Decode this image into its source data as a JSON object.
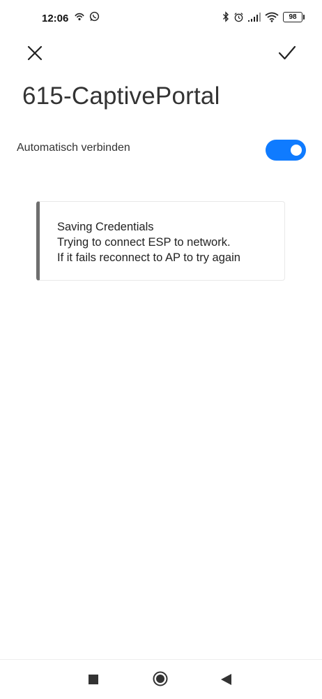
{
  "status_bar": {
    "time": "12:06",
    "battery": "98",
    "left_icons": [
      "hotspot-icon",
      "whatsapp-icon"
    ],
    "right_icons": [
      "bluetooth-icon",
      "alarm-icon",
      "signal-icon",
      "wifi-icon",
      "battery-icon"
    ]
  },
  "header": {
    "close_icon": "close-icon",
    "confirm_icon": "check-icon"
  },
  "network": {
    "ssid": "615-CaptivePortal"
  },
  "auto_connect": {
    "label": "Automatisch verbinden",
    "enabled": true,
    "accent_color": "#0f7bff"
  },
  "message_card": {
    "lines": [
      "Saving Credentials",
      "Trying to connect ESP to network.",
      "If it fails reconnect to AP to try again"
    ]
  },
  "nav_bar": {
    "items": [
      "recents-square-icon",
      "home-circle-icon",
      "back-triangle-icon"
    ]
  }
}
